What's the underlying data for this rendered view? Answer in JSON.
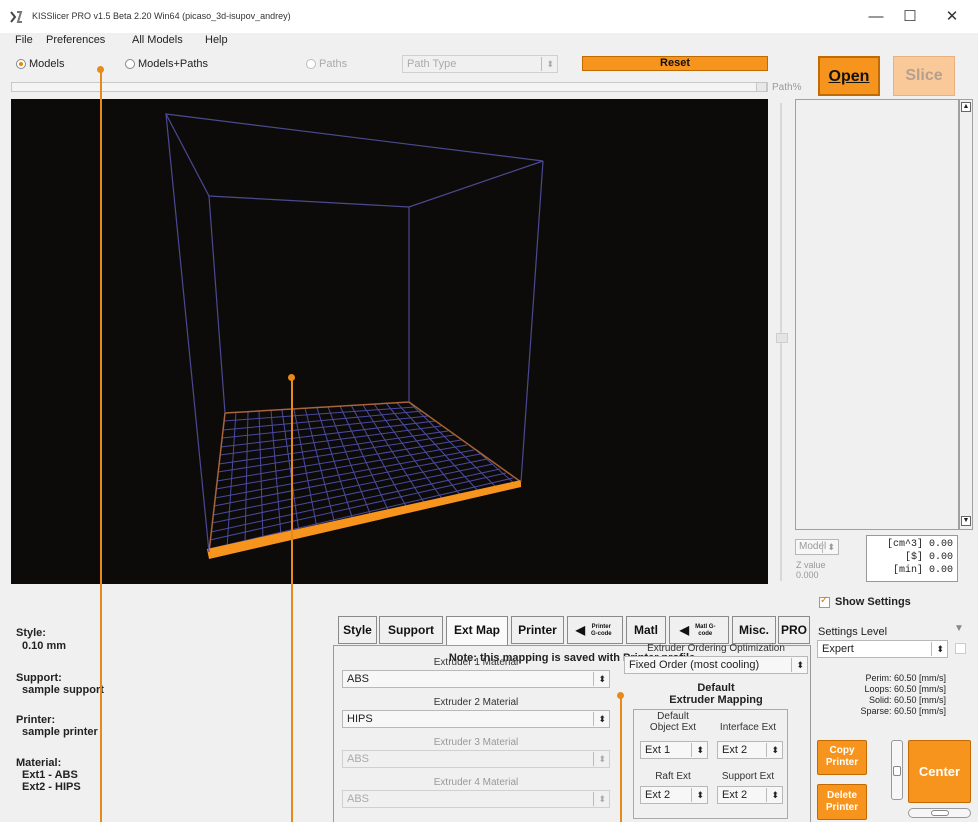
{
  "window": {
    "title": "KISSlicer PRO v1.5 Beta 2.20 Win64 (picaso_3d-isupov_andrey)",
    "min_glyph": "—",
    "max_glyph": "☐",
    "close_glyph": "✕"
  },
  "menu": [
    "File",
    "Preferences",
    "All Models",
    "Help"
  ],
  "toolbar": {
    "view_modes": [
      {
        "label": "Models",
        "selected": true,
        "enabled": true
      },
      {
        "label": "Models+Paths",
        "selected": false,
        "enabled": true
      },
      {
        "label": "Paths",
        "selected": false,
        "enabled": false
      }
    ],
    "path_type": {
      "value": "Path Type",
      "arrow": "⬍"
    },
    "reset_label": "Reset",
    "path_pct_label": "Path%",
    "open_label": "Open",
    "slice_label": "Slice"
  },
  "stats": {
    "model_select": "Model",
    "z_label": "Z value",
    "z_value": "0.000",
    "lines": [
      "[cm^3] 0.00",
      "[$] 0.00",
      "[min] 0.00"
    ]
  },
  "info": {
    "style_label": "Style:",
    "style_value": "0.10 mm",
    "support_label": "Support:",
    "support_value": "sample support",
    "printer_label": "Printer:",
    "printer_value": "sample printer",
    "material_label": "Material:",
    "material_values": [
      "Ext1 - ABS",
      "Ext2 - HIPS"
    ]
  },
  "tabs": [
    {
      "label": "Style"
    },
    {
      "label": "Support"
    },
    {
      "label": "Ext Map",
      "active": true
    },
    {
      "label": "Printer"
    },
    {
      "label": "Printer G-code",
      "small": true
    },
    {
      "label": "Matl"
    },
    {
      "label": "Matl G-code",
      "small": true
    },
    {
      "label": "Misc."
    },
    {
      "label": "PRO"
    }
  ],
  "ext_map": {
    "note": "Note: this mapping is saved with Printer profile",
    "extruders": [
      {
        "label": "Extruder 1 Material",
        "value": "ABS",
        "enabled": true
      },
      {
        "label": "Extruder 2 Material",
        "value": "HIPS",
        "enabled": true
      },
      {
        "label": "Extruder 3 Material",
        "value": "ABS",
        "enabled": false
      },
      {
        "label": "Extruder 4 Material",
        "value": "ABS",
        "enabled": false
      }
    ],
    "ordering_label": "Extruder Ordering Optimization",
    "ordering_value": "Fixed Order (most cooling)",
    "default_title_1": "Default",
    "default_title_2": "Extruder Mapping",
    "object_label_1": "Default",
    "object_label_2": "Object Ext",
    "object_value": "Ext 1",
    "interface_label": "Interface Ext",
    "interface_value": "Ext 2",
    "raft_label": "Raft Ext",
    "raft_value": "Ext 2",
    "support_label": "Support Ext",
    "support_value": "Ext 2"
  },
  "settings": {
    "show_settings_label": "Show Settings",
    "level_label": "Settings Level",
    "level_value": "Expert",
    "speeds": [
      "Perim: 60.50 [mm/s]",
      "Loops: 60.50 [mm/s]",
      "Solid: 60.50 [mm/s]",
      "Sparse: 60.50 [mm/s]"
    ],
    "copy_printer_1": "Copy",
    "copy_printer_2": "Printer",
    "delete_printer_1": "Delete",
    "delete_printer_2": "Printer",
    "center_label": "Center"
  },
  "colors": {
    "accent": "#f7941d",
    "viewport_bg": "#0d0b0a",
    "bed_grid": "#4a4aa0",
    "bed_edge": "#f7941d",
    "annotation": "#e88a1a"
  }
}
